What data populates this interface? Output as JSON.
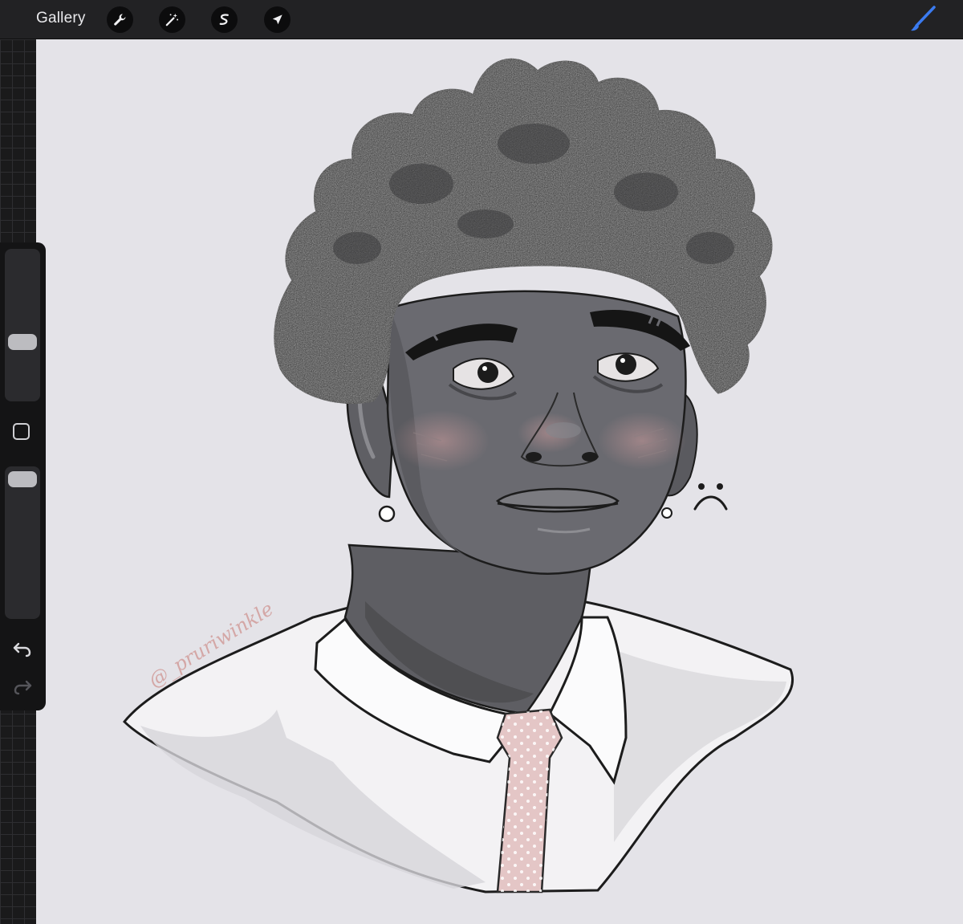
{
  "toolbar": {
    "gallery_label": "Gallery",
    "tools": [
      "wrench-icon",
      "magic-wand-icon",
      "selection-icon",
      "move-arrow-icon"
    ],
    "brush_color": "#3b7bf0"
  },
  "sidebar": {
    "brush_size_level": 0.37,
    "opacity_level": 1.0,
    "icons": [
      "modify-square-icon",
      "undo-icon",
      "redo-icon"
    ]
  },
  "canvas": {
    "watermark": "@_pruriwinkle",
    "background_color": "#e4e3e8"
  }
}
